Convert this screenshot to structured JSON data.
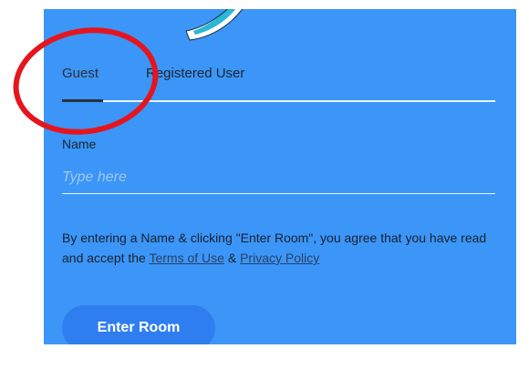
{
  "tabs": {
    "guest": "Guest",
    "registered": "Registered User"
  },
  "form": {
    "name_label": "Name",
    "name_placeholder": "Type here",
    "name_value": ""
  },
  "consent": {
    "text_before": "By entering a Name & clicking \"Enter Room\", you agree that you have read and accept the ",
    "terms_link": "Terms of Use",
    "separator": " & ",
    "privacy_link": "Privacy Policy"
  },
  "actions": {
    "enter_room": "Enter Room"
  },
  "colors": {
    "panel_background": "#3b96f7",
    "button_background": "#2f7ef0",
    "annotation_circle": "#e5151e"
  },
  "state": {
    "active_tab": "guest"
  }
}
